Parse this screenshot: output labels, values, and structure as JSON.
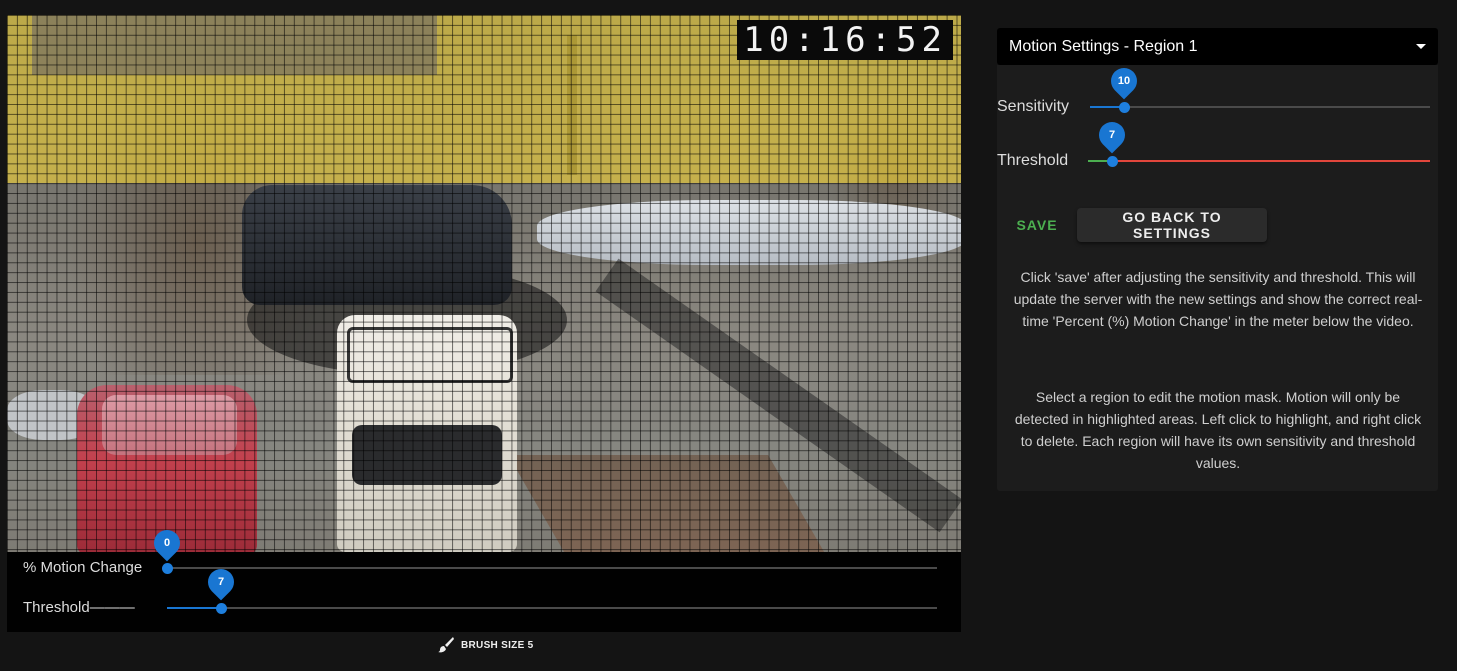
{
  "video": {
    "timestamp": "10:16:52",
    "mask_region_color": "#ebcd3c"
  },
  "meter": {
    "motion_change": {
      "label": "% Motion Change",
      "value": "0",
      "percent": 0
    },
    "threshold": {
      "label": "Threshold———",
      "value": "7",
      "percent": 7
    }
  },
  "brush": {
    "label": "BRUSH SIZE 5",
    "icon": "brush-icon"
  },
  "panel": {
    "region_select": {
      "selected": "Motion Settings - Region 1"
    },
    "sensitivity": {
      "label": "Sensitivity",
      "value": "10",
      "percent": 10
    },
    "threshold": {
      "label": "Threshold",
      "value": "7",
      "percent": 7
    },
    "save_label": "SAVE",
    "back_label": "GO BACK TO SETTINGS",
    "help_1": "Click 'save' after adjusting the sensitivity and threshold. This will update the server with the new settings and show the correct real-time 'Percent (%) Motion Change' in the meter below the video.",
    "help_2": "Select a region to edit the motion mask. Motion will only be detected in highlighted areas. Left click to highlight, and right click to delete. Each region will have its own sensitivity and threshold values."
  },
  "colors": {
    "accent": "#1976d2",
    "save_green": "#4caf50",
    "threshold_red": "#e2463c",
    "threshold_green": "#4caf50"
  }
}
